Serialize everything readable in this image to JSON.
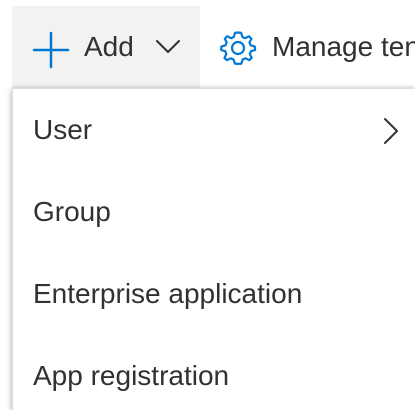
{
  "toolbar": {
    "add_label": "Add",
    "add_icon": "plus-icon",
    "add_dropdown_icon": "chevron-down-icon",
    "manage_label": "Manage tenants",
    "manage_icon": "gear-icon"
  },
  "menu": {
    "items": [
      {
        "label": "User",
        "has_submenu": true,
        "submenu_icon": "chevron-right-icon"
      },
      {
        "label": "Group",
        "has_submenu": false
      },
      {
        "label": "Enterprise application",
        "has_submenu": false
      },
      {
        "label": "App registration",
        "has_submenu": false
      }
    ]
  },
  "colors": {
    "accent": "#0078d4",
    "text": "#323130",
    "hover_background": "#f3f2f1",
    "menu_background": "#ffffff"
  }
}
